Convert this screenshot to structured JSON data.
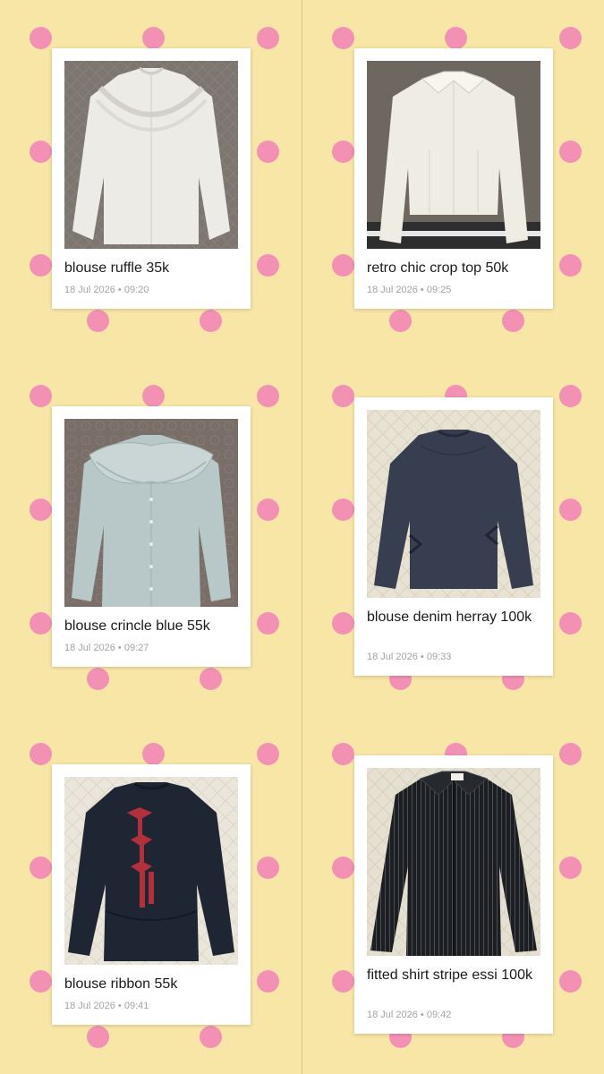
{
  "colors": {
    "background": "#f8e6a6",
    "dot": "#f391b5",
    "card": "#ffffff"
  },
  "posts": [
    {
      "title": "blouse ruffle 35k",
      "date": "18 Jul 2026 • 09:20",
      "garment": "white ruffle blouse"
    },
    {
      "title": "retro chic crop top 50k",
      "date": "18 Jul 2026 • 09:25",
      "garment": "cream collared crop top"
    },
    {
      "title": "blouse crincle blue 55k",
      "date": "18 Jul 2026 • 09:27",
      "garment": "light blue crinkle blouse"
    },
    {
      "title": "blouse denim herray 100k",
      "date": "18 Jul 2026 • 09:33",
      "garment": "dark denim blouse"
    },
    {
      "title": "blouse ribbon 55k",
      "date": "18 Jul 2026 • 09:41",
      "garment": "navy blouse with red ribbons"
    },
    {
      "title": "fitted shirt stripe essi 100k",
      "date": "18 Jul 2026 • 09:42",
      "garment": "black striped fitted shirt"
    }
  ]
}
